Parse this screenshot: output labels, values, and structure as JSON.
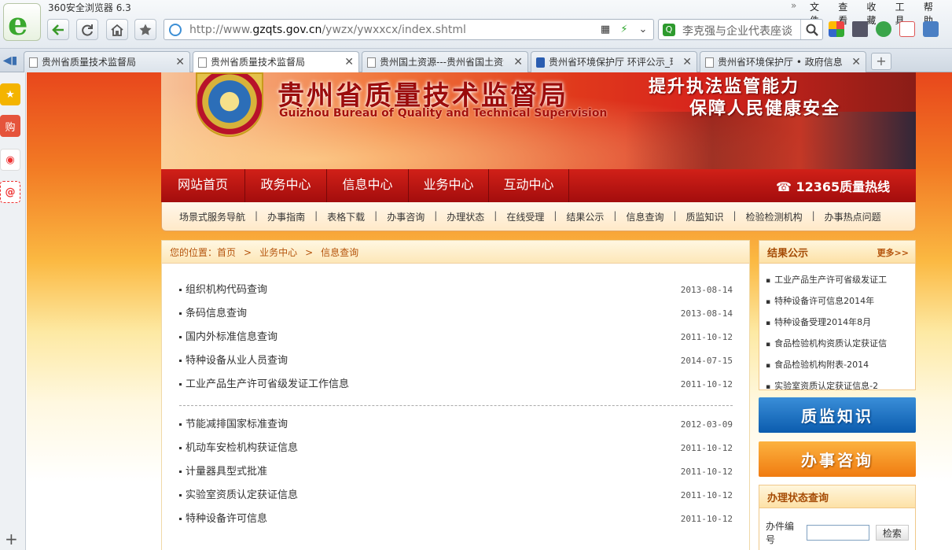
{
  "browser": {
    "title": "360安全浏览器 6.3",
    "menu": [
      "文件",
      "查看",
      "收藏",
      "工具",
      "帮助"
    ],
    "url_prefix": "http://www.",
    "url_domain": "gzqts.gov.cn",
    "url_path": "/ywzx/ywxxcx/index.shtml",
    "search_query": "李克强与企业代表座谈",
    "tabs": [
      {
        "label": "贵州省质量技术监督局",
        "active": false
      },
      {
        "label": "贵州省质量技术监督局",
        "active": true
      },
      {
        "label": "贵州国土资源---贵州省国土资源厅",
        "active": false
      },
      {
        "label": "贵州省环境保护厅 环评公示_环",
        "active": false
      },
      {
        "label": "贵州省环境保护厅 • 政府信息公开",
        "active": false
      }
    ],
    "new_tab": "+",
    "sidebar_icon_labels": {
      "shop": "购",
      "mail": "@"
    }
  },
  "site": {
    "cn_title": "贵州省质量技术监督局",
    "en_title": "Guizhou Bureau of Quality and Technical Supervision",
    "slogan_line1": "提升执法监管能力",
    "slogan_line2": "保障人民健康安全",
    "nav": [
      "网站首页",
      "政务中心",
      "信息中心",
      "业务中心",
      "互动中心"
    ],
    "hotline": "12365质量热线",
    "subnav": [
      "场景式服务导航",
      "办事指南",
      "表格下载",
      "办事咨询",
      "办理状态",
      "在线受理",
      "结果公示",
      "信息查询",
      "质监知识",
      "检验检测机构",
      "办事热点问题"
    ],
    "breadcrumb": {
      "prefix": "您的位置：",
      "items": [
        "首页",
        "业务中心",
        "信息查询"
      ]
    },
    "list_group1": [
      {
        "title": "组织机构代码查询",
        "date": "2013-08-14"
      },
      {
        "title": "条码信息查询",
        "date": "2013-08-14"
      },
      {
        "title": "国内外标准信息查询",
        "date": "2011-10-12"
      },
      {
        "title": "特种设备从业人员查询",
        "date": "2014-07-15"
      },
      {
        "title": "工业产品生产许可省级发证工作信息",
        "date": "2011-10-12"
      }
    ],
    "list_group2": [
      {
        "title": "节能减排国家标准查询",
        "date": "2012-03-09"
      },
      {
        "title": "机动车安检机构获证信息",
        "date": "2011-10-12"
      },
      {
        "title": "计量器具型式批准",
        "date": "2011-10-12"
      },
      {
        "title": "实验室资质认定获证信息",
        "date": "2011-10-12"
      },
      {
        "title": "特种设备许可信息",
        "date": "2011-10-12"
      }
    ],
    "results": {
      "title": "结果公示",
      "more": "更多>>",
      "items": [
        "工业产品生产许可省级发证工",
        "特种设备许可信息2014年",
        "特种设备受理2014年8月",
        "食品检验机构资质认定获证信",
        "食品检验机构附表-2014",
        "实验室资质认定获证信息-2"
      ]
    },
    "promo_knowledge": "质监知识",
    "promo_consult": "办事咨询",
    "status_query": {
      "title": "办理状态查询",
      "label": "办件编号",
      "button": "检索"
    }
  },
  "colors": {
    "brand_red": "#c5170f",
    "accent_orange": "#b5540c"
  }
}
